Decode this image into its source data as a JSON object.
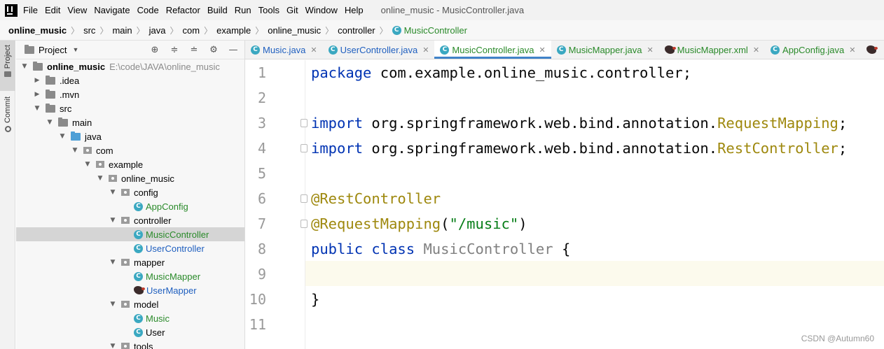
{
  "menubar": {
    "items": [
      "File",
      "Edit",
      "View",
      "Navigate",
      "Code",
      "Refactor",
      "Build",
      "Run",
      "Tools",
      "Git",
      "Window",
      "Help"
    ],
    "window_title": "online_music - MusicController.java"
  },
  "breadcrumbs": [
    "online_music",
    "src",
    "main",
    "java",
    "com",
    "example",
    "online_music",
    "controller",
    "MusicController"
  ],
  "tool_strip": {
    "project_tab": "Project",
    "commit_tab": "Commit"
  },
  "project_panel": {
    "title": "Project",
    "tree": [
      {
        "label": "online_music",
        "path": "E:\\code\\JAVA\\online_music"
      },
      {
        "label": ".idea"
      },
      {
        "label": ".mvn"
      },
      {
        "label": "src"
      },
      {
        "label": "main"
      },
      {
        "label": "java"
      },
      {
        "label": "com"
      },
      {
        "label": "example"
      },
      {
        "label": "online_music"
      },
      {
        "label": "config"
      },
      {
        "label": "AppConfig"
      },
      {
        "label": "controller"
      },
      {
        "label": "MusicController"
      },
      {
        "label": "UserController"
      },
      {
        "label": "mapper"
      },
      {
        "label": "MusicMapper"
      },
      {
        "label": "UserMapper"
      },
      {
        "label": "model"
      },
      {
        "label": "Music"
      },
      {
        "label": "User"
      },
      {
        "label": "tools"
      }
    ]
  },
  "editor_tabs": [
    "Music.java",
    "UserController.java",
    "MusicController.java",
    "MusicMapper.java",
    "MusicMapper.xml",
    "AppConfig.java"
  ],
  "editor": {
    "line_numbers": [
      "1",
      "2",
      "3",
      "4",
      "5",
      "6",
      "7",
      "8",
      "9",
      "10",
      "11"
    ],
    "line1": {
      "kw": "package",
      "rest": " com.example.online_music.controller;"
    },
    "line3": {
      "kw": "import",
      "rest": " org.springframework.web.bind.annotation.",
      "cls": "RequestMapping",
      "end": ";"
    },
    "line4": {
      "kw": "import",
      "rest": " org.springframework.web.bind.annotation.",
      "cls": "RestController",
      "end": ";"
    },
    "line6": {
      "anno": "@RestController"
    },
    "line7": {
      "anno": "@RequestMapping",
      "open": "(",
      "str": "\"/music\"",
      "close": ")"
    },
    "line8": {
      "kw1": "public",
      "kw2": "class",
      "cname": "MusicController",
      "brace": " {"
    },
    "line10": {
      "brace": "}"
    }
  },
  "watermark": "CSDN @Autumn60",
  "colors": {
    "accent": "#4083c9",
    "keyword": "#0033b3",
    "annotation": "#9e880d",
    "string": "#067d17",
    "class_icon": "#3aa8c1"
  }
}
